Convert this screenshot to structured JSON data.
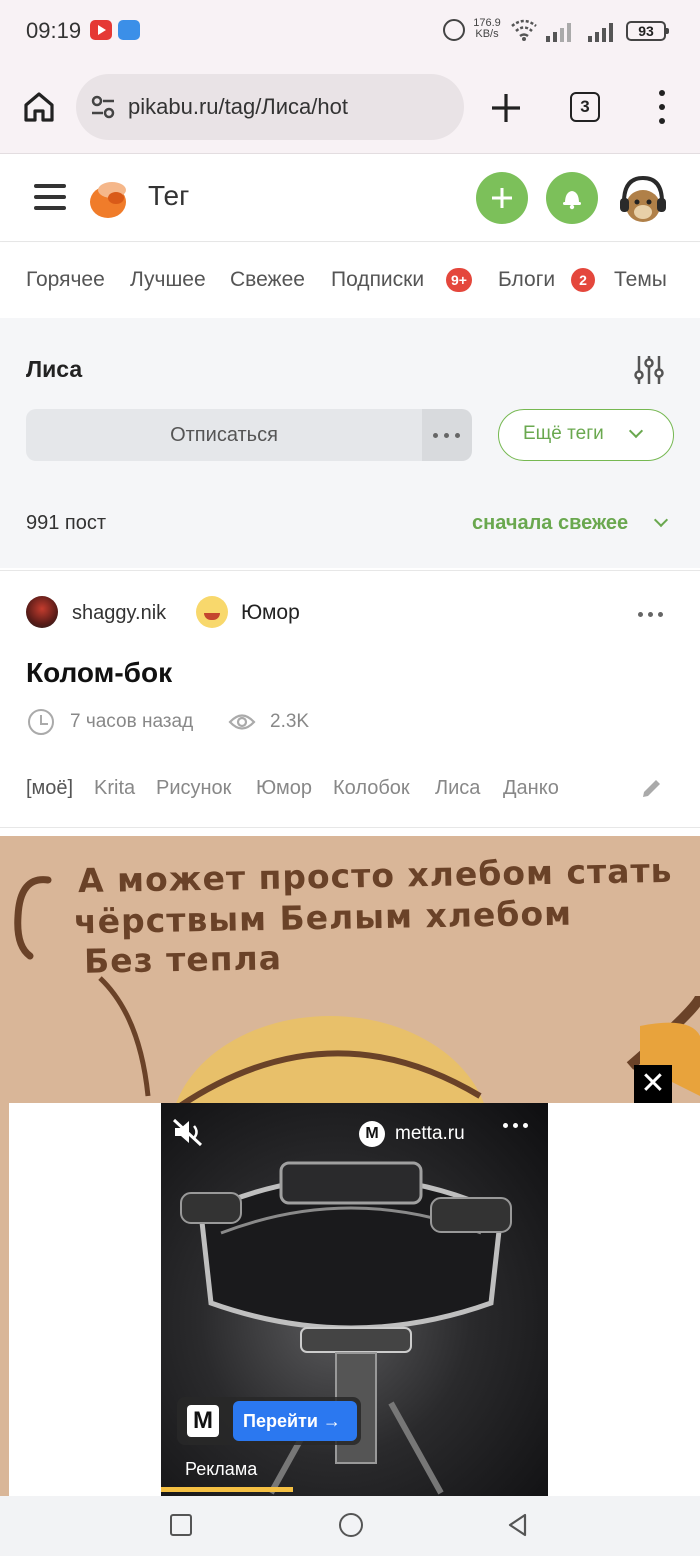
{
  "status_bar": {
    "time": "09:19",
    "net_speed_value": "176.9",
    "net_speed_unit": "KB/s",
    "battery": "93"
  },
  "browser": {
    "url": "pikabu.ru/tag/Лиса/hot",
    "tab_count": "3"
  },
  "header": {
    "title": "Тег"
  },
  "nav": {
    "tabs": [
      {
        "label": "Горячее"
      },
      {
        "label": "Лучшее"
      },
      {
        "label": "Свежее"
      },
      {
        "label": "Подписки",
        "badge": "9+"
      },
      {
        "label": "Блоги",
        "badge": "2"
      },
      {
        "label": "Темы"
      }
    ]
  },
  "tag": {
    "name": "Лиса",
    "unsubscribe_label": "Отписаться",
    "more_tags_label": "Ещё теги",
    "post_count": "991 пост",
    "sort_label": "сначала свежее"
  },
  "post": {
    "author": "shaggy.nik",
    "community": "Юмор",
    "title": "Колом-бок",
    "time": "7 часов назад",
    "views": "2.3K",
    "tags": [
      "[моё]",
      "Krita",
      "Рисунок",
      "Юмор",
      "Колобок",
      "Лиса",
      "Данко"
    ],
    "image_text": [
      "А может просто хлебом стать",
      "чёрствым Белым хлебом",
      "Без тепла"
    ]
  },
  "ad": {
    "close": "✕",
    "domain": "metta.ru",
    "brand_letter": "M",
    "cta_label": "Перейти →",
    "label": "Реклама",
    "progress": 0.34
  },
  "colors": {
    "accent_green": "#7cc05a",
    "badge_red": "#e4473c",
    "cta_blue": "#2b78f0"
  }
}
